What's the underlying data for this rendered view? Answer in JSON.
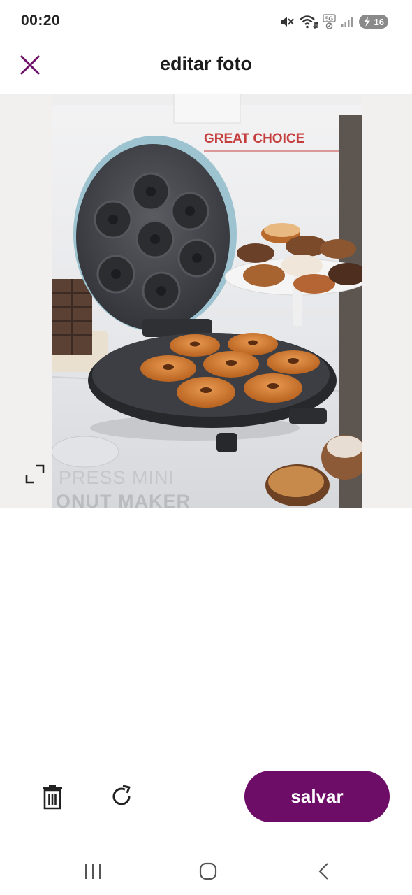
{
  "status_bar": {
    "time": "00:20",
    "network_label": "5G",
    "battery_level": "16",
    "icons": [
      "mute-icon",
      "wifi-icon",
      "5g-icon",
      "signal-icon",
      "battery-icon"
    ]
  },
  "header": {
    "title": "editar foto",
    "close_icon": "close-icon",
    "accent_color": "#6d0d67"
  },
  "photo": {
    "brand_text": "GREAT CHOICE",
    "product_line1": "PRESS MINI",
    "product_line2": "ONUT MAKER",
    "expand_icon": "expand-icon"
  },
  "toolbar": {
    "delete_icon": "trash-icon",
    "rotate_icon": "rotate-icon",
    "save_label": "salvar",
    "save_color": "#6d0d67"
  },
  "nav_bar": {
    "icons": [
      "recent-apps-icon",
      "home-icon",
      "back-icon"
    ]
  }
}
